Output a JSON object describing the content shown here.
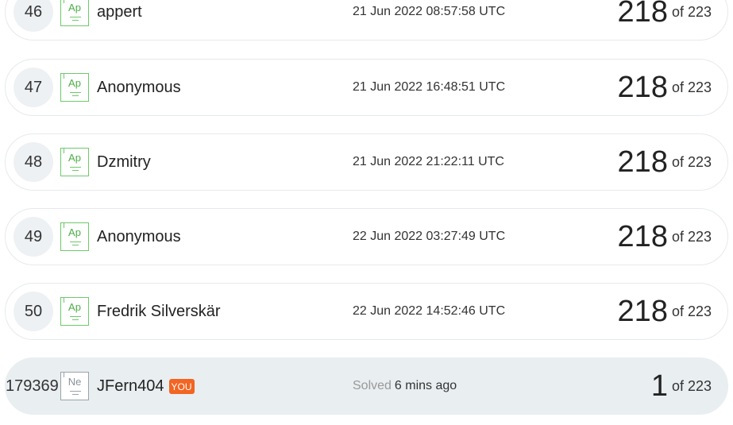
{
  "leaderboard": {
    "rows": [
      {
        "rank": "46",
        "level_symbol": "Ap",
        "name": "appert",
        "time": "21 Jun 2022 08:57:58 UTC",
        "score": "218",
        "total": "of 223"
      },
      {
        "rank": "47",
        "level_symbol": "Ap",
        "name": "Anonymous",
        "time": "21 Jun 2022 16:48:51 UTC",
        "score": "218",
        "total": "of 223"
      },
      {
        "rank": "48",
        "level_symbol": "Ap",
        "name": "Dzmitry",
        "time": "21 Jun 2022 21:22:11 UTC",
        "score": "218",
        "total": "of 223"
      },
      {
        "rank": "49",
        "level_symbol": "Ap",
        "name": "Anonymous",
        "time": "22 Jun 2022 03:27:49 UTC",
        "score": "218",
        "total": "of 223"
      },
      {
        "rank": "50",
        "level_symbol": "Ap",
        "name": "Fredrik Silverskär",
        "time": "22 Jun 2022 14:52:46 UTC",
        "score": "218",
        "total": "of 223"
      }
    ],
    "current_user": {
      "rank": "179369",
      "level_symbol": "Ne",
      "name": "JFern404",
      "badge": "YOU",
      "solved_label": "Solved",
      "solved_time": "6 mins ago",
      "score": "1",
      "total": "of 223"
    }
  },
  "colors": {
    "level_green": "#6ec96a",
    "level_gray": "#9aa3aa",
    "you_badge": "#f26522",
    "current_row_bg": "#e9eef1"
  },
  "icons": {
    "level_badge": "periodic-element-icon"
  }
}
